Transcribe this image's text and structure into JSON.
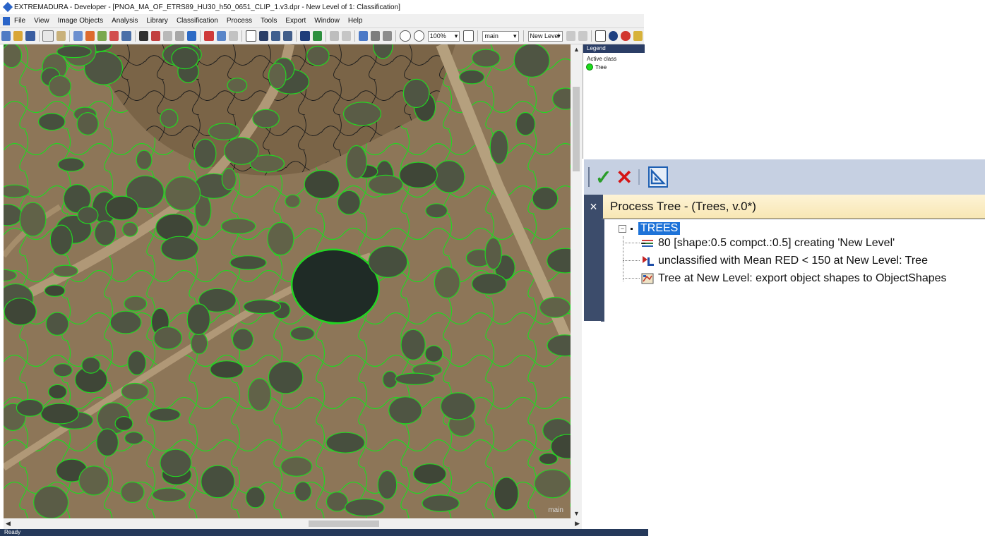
{
  "window": {
    "title": "EXTREMADURA - Developer - [PNOA_MA_OF_ETRS89_HU30_h50_0651_CLIP_1.v3.dpr - New Level of 1: Classification]"
  },
  "menu": [
    "File",
    "View",
    "Image Objects",
    "Analysis",
    "Library",
    "Classification",
    "Process",
    "Tools",
    "Export",
    "Window",
    "Help"
  ],
  "toolbar": {
    "zoom_value": "100%",
    "view_value": "main",
    "level_value": "New Level"
  },
  "image_view": {
    "label": "main"
  },
  "status": {
    "text": "Ready"
  },
  "legend": {
    "header": "Legend",
    "active_class_label": "Active class",
    "classes": [
      {
        "name": "Tree",
        "color": "#1ddc1d"
      }
    ]
  },
  "process_tree": {
    "title": "Process Tree - (Trees, v.0*)",
    "root": "TREES",
    "items": [
      {
        "text": "80 [shape:0.5 compct.:0.5] creating 'New Level'",
        "icon": "segmentation-icon"
      },
      {
        "text": "unclassified with Mean RED < 150  at  New Level: Tree",
        "icon": "classification-icon"
      },
      {
        "text": "Tree at  New Level: export object shapes to ObjectShapes",
        "icon": "export-icon"
      }
    ]
  },
  "colors": {
    "segment_border": "#22d622",
    "panel_header": "#2b3e66"
  }
}
